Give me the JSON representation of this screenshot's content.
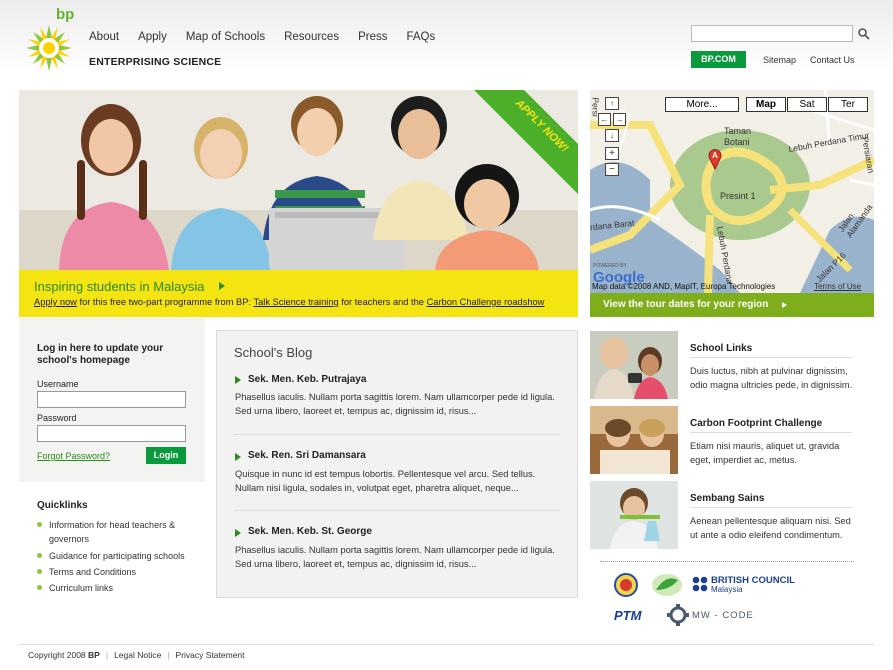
{
  "header": {
    "brand": "bp",
    "nav": [
      "About",
      "Apply",
      "Map of Schools",
      "Resources",
      "Press",
      "FAQs"
    ],
    "tagline": "ENTERPRISING SCIENCE",
    "search": {
      "placeholder": "",
      "value": ""
    },
    "bpcom_label": "BP.COM",
    "sitemap_label": "Sitemap",
    "contact_label": "Contact Us"
  },
  "hero": {
    "ribbon": "APPLY NOW!",
    "title": "Inspiring students in Malaysia",
    "desc_apply": "Apply now",
    "desc_mid1": " for this free two-part programme from BP: ",
    "desc_link1": "Talk Science training",
    "desc_mid2": " for teachers and the ",
    "desc_link2": "Carbon Challenge roadshow"
  },
  "map": {
    "buttons": {
      "more": "More...",
      "map": "Map",
      "sat": "Sat",
      "ter": "Ter"
    },
    "labels": {
      "taman_botani": "Taman\nBotani",
      "presint": "Presint 1",
      "lebuh_timur": "Lebuh Perdana Timur",
      "perdana_barat": "rdana Barat",
      "lebuh_perdana": "Lebuh Perdana",
      "jalan_p16": "Jalan P16",
      "jalan_alamanda": "Jalan Alamanda",
      "persiaran": "Persiaran",
      "persi": "Persi",
      "powered": "POWERED BY",
      "google": "Google",
      "marker": "A",
      "data": "Map data ©2008 AND, MapIT, Europa Technologies",
      "terms": "Terms of Use"
    },
    "cta": "View the tour dates for your region"
  },
  "login": {
    "title": "Log in here to update your school's homepage",
    "username_label": "Username",
    "password_label": "Password",
    "forgot": "Forgot Password?",
    "button": "Login"
  },
  "quicklinks": {
    "title": "Quicklinks",
    "items": [
      "Information for head teachers &",
      "governors",
      "Guidance for participating schools",
      "Terms and Conditions",
      "Curriculum links"
    ]
  },
  "blog": {
    "title": "School's Blog",
    "posts": [
      {
        "heading": "Sek. Men. Keb. Putrajaya",
        "line1": "Phasellus iaculis. Nullam porta sagittis lorem. Nam ullamcorper pede id ligula.",
        "line2": "Sed urna libero, laoreet et, tempus ac, dignissim id, risus..."
      },
      {
        "heading": "Sek. Ren. Sri Damansara",
        "line1": "Quisque in nunc id est tempus lobortis. Pellentesque vel arcu. Sed tellus.",
        "line2": "Nullam nisi ligula, sodales in, volutpat eget, pharetra aliquet, neque..."
      },
      {
        "heading": "Sek. Men. Keb. St. George",
        "line1": "Phasellus iaculis. Nullam porta sagittis lorem. Nam ullamcorper pede id ligula.",
        "line2": "Sed urna libero, laoreet et, tempus ac, dignissim id, risus..."
      }
    ]
  },
  "features": [
    {
      "title": "School Links",
      "line1": "Duis luctus, nibh at pulvinar dignissim,",
      "line2": "odio magna ultricies pede, in dignissim."
    },
    {
      "title": "Carbon Footprint Challenge",
      "line1": "Etiam nisi mauris, aliquet ut, gravida",
      "line2": "eget, imperdiet ac, metus."
    },
    {
      "title": "Sembang Sains",
      "line1": "Aenean pellentesque aliquam nisi. Sed",
      "line2": "ut ante a odio eleifend condimentum."
    }
  ],
  "partners": {
    "british_council": "BRITISH COUNCIL",
    "british_council_sub": "Malaysia",
    "ptm": "PTM",
    "mw_code": "MW - CODE"
  },
  "footer": {
    "copyright": "Copyright 2008",
    "copyright_brand": "BP",
    "legal": "Legal Notice",
    "privacy": "Privacy Statement"
  },
  "colors": {
    "bp_green": "#099a3d",
    "hero_yellow": "#f4e412",
    "map_bar_green": "#7fae1c",
    "text_green": "#2d8a1d"
  }
}
